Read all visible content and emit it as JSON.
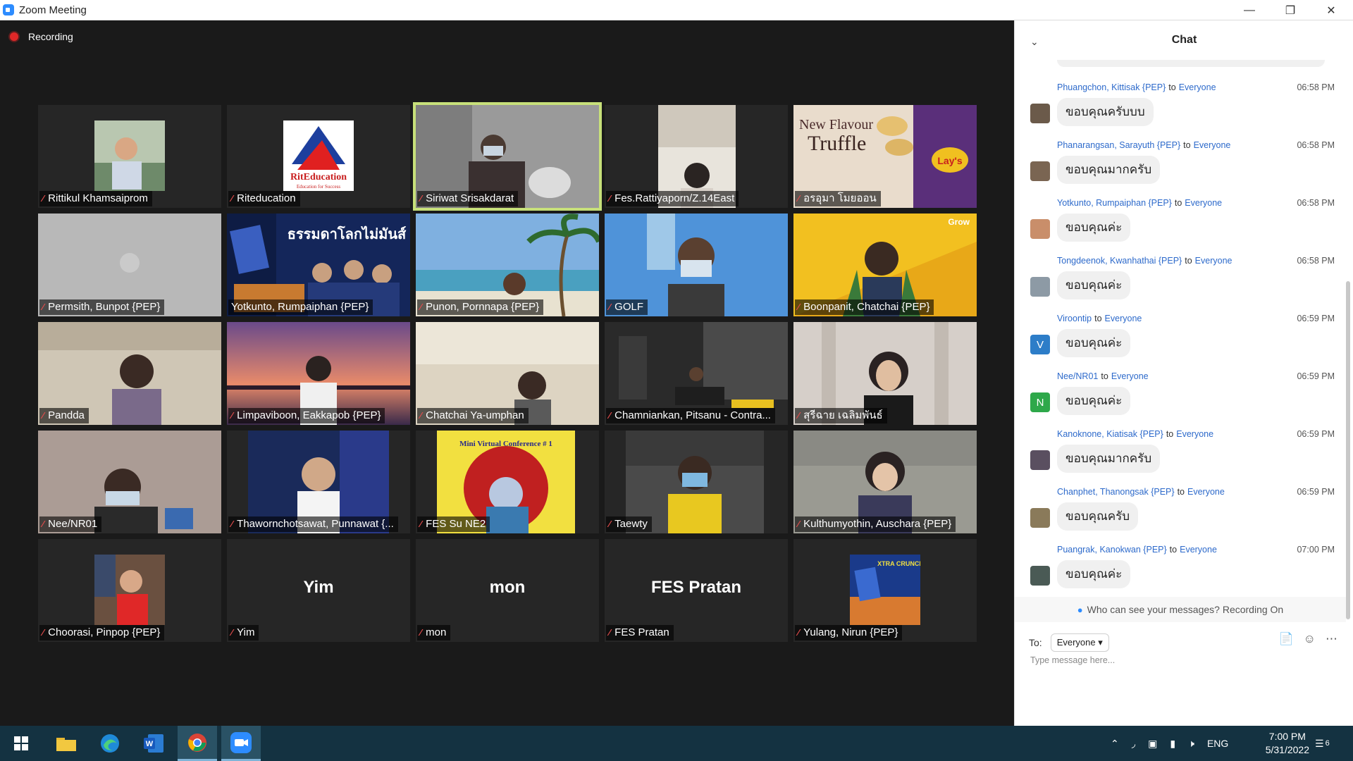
{
  "window": {
    "title": "Zoom Meeting",
    "minimize": "—",
    "restore": "❐",
    "close": "✕"
  },
  "recording": {
    "label": "Recording"
  },
  "participants": [
    {
      "name": "Rittikul Khamsaiprom"
    },
    {
      "name": "Riteducation",
      "logo_title": "RitEducation",
      "logo_sub": "Education for Success"
    },
    {
      "name": "Siriwat Srisakdarat",
      "active": true
    },
    {
      "name": "Fes.Rattiyaporn/Z.14East"
    },
    {
      "name": "อรอุมา โมยออน",
      "promo_line1": "New Flavour",
      "promo_line2": "Truffle",
      "brand": "Lay's"
    },
    {
      "name": "Permsith, Bunpot {PEP}"
    },
    {
      "name": "Yotkunto, Rumpaiphan {PEP}",
      "banner": "ธรรมดาโลกไม่มันส์"
    },
    {
      "name": "Punon, Pornnapa {PEP}"
    },
    {
      "name": "GOLF"
    },
    {
      "name": "Boonpanit, Chatchai {PEP}",
      "sign": "Grow"
    },
    {
      "name": "Pandda"
    },
    {
      "name": "Limpaviboon, Eakkapob {PEP}"
    },
    {
      "name": "Chatchai Ya-umphan"
    },
    {
      "name": "Chamniankan, Pitsanu - Contra..."
    },
    {
      "name": "สุรีฉาย เฉลิมพันธ์"
    },
    {
      "name": "Nee/NR01"
    },
    {
      "name": "Thawornchotsawat, Punnawat {..."
    },
    {
      "name": "FES Su NE2",
      "banner": "Mini Virtual Conference # 1"
    },
    {
      "name": "Taewty"
    },
    {
      "name": "Kulthumyothin, Auschara {PEP}"
    },
    {
      "name": "Choorasi, Pinpop {PEP}"
    },
    {
      "name": "Yim",
      "display": "Yim"
    },
    {
      "name": "mon",
      "display": "mon"
    },
    {
      "name": "FES Pratan",
      "display": "FES Pratan"
    },
    {
      "name": "Yulang, Nirun {PEP}",
      "banner": "XTRA CRUNCH"
    }
  ],
  "chat": {
    "title": "Chat",
    "to_word": "to",
    "messages": [
      {
        "sender": "Phuangchon, Kittisak {PEP}",
        "recipient": "Everyone",
        "time": "06:58 PM",
        "text": "ขอบคุณครับบบ",
        "avatar_color": "#6b5a4a"
      },
      {
        "sender": "Phanarangsan, Sarayuth {PEP}",
        "recipient": "Everyone",
        "time": "06:58 PM",
        "text": "ขอบคุณมากครับ",
        "avatar_color": "#7a6552"
      },
      {
        "sender": "Yotkunto, Rumpaiphan {PEP}",
        "recipient": "Everyone",
        "time": "06:58 PM",
        "text": "ขอบคุณค่ะ",
        "avatar_color": "#c98e6a"
      },
      {
        "sender": "Tongdeenok, Kwanhathai {PEP}",
        "recipient": "Everyone",
        "time": "06:58 PM",
        "text": "ขอบคุณค่ะ",
        "avatar_color": "#8d9aa5"
      },
      {
        "sender": "Viroontip",
        "recipient": "Everyone",
        "time": "06:59 PM",
        "text": "ขอบคุณค่ะ",
        "avatar_letter": "V",
        "avatar_color": "#2d7dc8"
      },
      {
        "sender": "Nee/NR01",
        "recipient": "Everyone",
        "time": "06:59 PM",
        "text": "ขอบคุณค่ะ",
        "avatar_letter": "N",
        "avatar_color": "#2ea84a"
      },
      {
        "sender": "Kanoknone, Kiatisak {PEP}",
        "recipient": "Everyone",
        "time": "06:59 PM",
        "text": "ขอบคุณมากครับ",
        "avatar_color": "#5a4f60"
      },
      {
        "sender": "Chanphet, Thanongsak {PEP}",
        "recipient": "Everyone",
        "time": "06:59 PM",
        "text": "ขอบคุณครับ",
        "avatar_color": "#8a7a5a"
      },
      {
        "sender": "Puangrak, Kanokwan {PEP}",
        "recipient": "Everyone",
        "time": "07:00 PM",
        "text": "ขอบคุณค่ะ",
        "avatar_color": "#4a5a55"
      }
    ],
    "visibility_notice": "Who can see your messages? Recording On",
    "to_label": "To:",
    "to_value": "Everyone",
    "input_placeholder": "Type message here..."
  },
  "taskbar": {
    "language": "ENG",
    "time": "7:00 PM",
    "date": "5/31/2022",
    "notification_count": "6"
  }
}
